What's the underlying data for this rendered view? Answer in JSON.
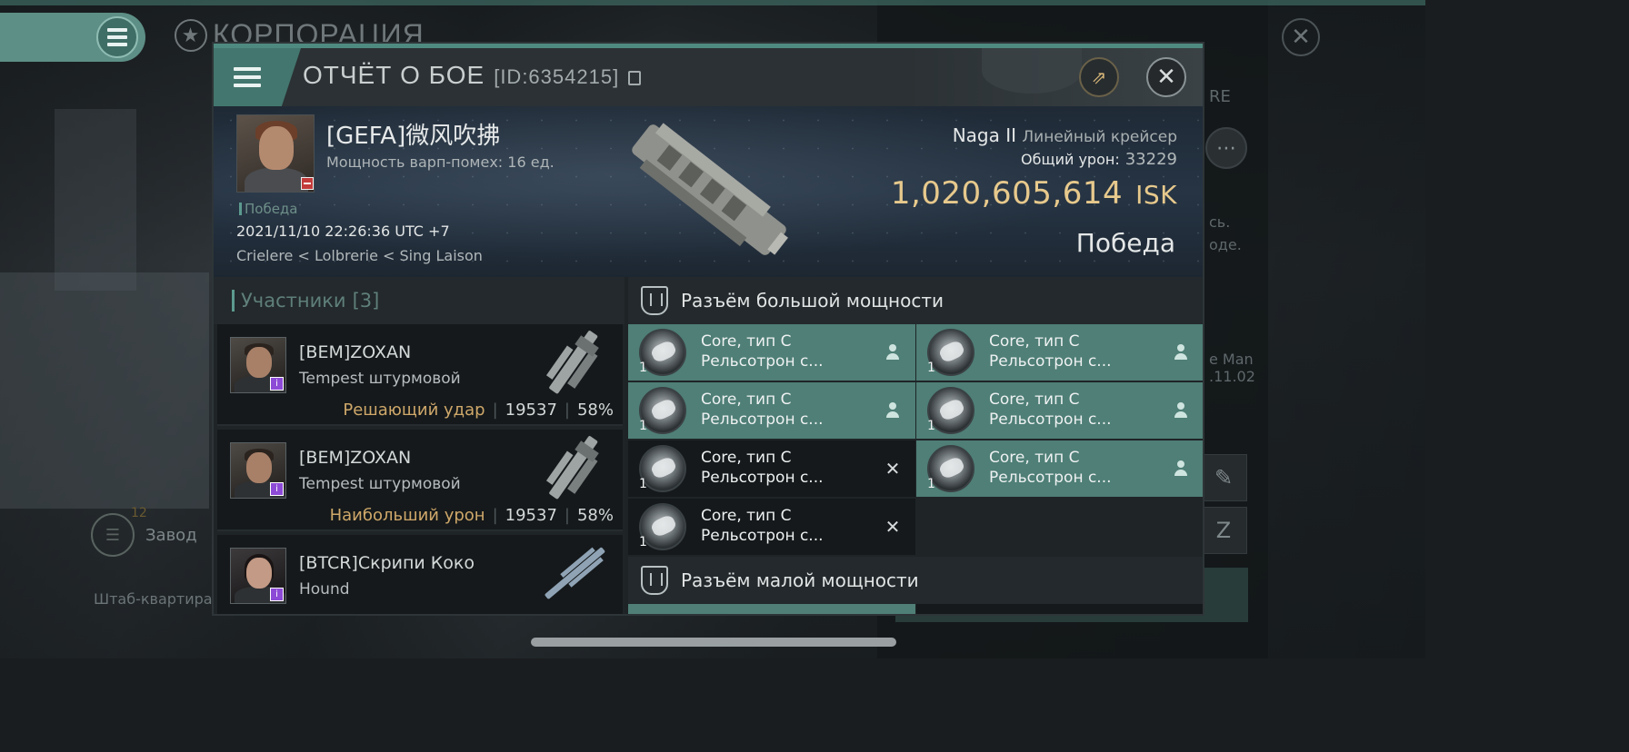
{
  "background": {
    "corp_title": "КОРПОРАЦИЯ",
    "side_fragment_re": "RE",
    "side_text_1": "сь.",
    "side_text_2": "оде.",
    "side_text_3": "e Man",
    "side_text_4": ".11.02",
    "factory_label": "Завод",
    "factory_count": "12",
    "hq_label": "Штаб-квартира"
  },
  "report": {
    "title": "ОТЧЁТ О БОЕ",
    "id": "[ID:6354215]"
  },
  "victim": {
    "pilot": "[GEFA]微风吹拂",
    "warp": "Мощность варп-помех: 16 ед.",
    "tag": "Победа",
    "datetime": "2021/11/10 22:26:36 UTC +7",
    "location": "Crielere < Lolbrerie < Sing Laison",
    "ship_name": "Naga II",
    "ship_class": "Линейный крейсер",
    "total_damage_label": "Общий урон:",
    "total_damage": "33229",
    "value": "1,020,605,614",
    "currency": "ISK",
    "result": "Победа"
  },
  "participants": {
    "label": "Участники",
    "count": "[3]",
    "rows": [
      {
        "name": "[BEM]ZOXAN",
        "ship": "Tempest штурмовой",
        "role": "Решающий удар",
        "damage": "19537",
        "percent": "58%"
      },
      {
        "name": "[BEM]ZOXAN",
        "ship": "Tempest штурмовой",
        "role": "Наибольший урон",
        "damage": "19537",
        "percent": "58%"
      },
      {
        "name": "[BTCR]Скрипи Коко",
        "ship": "Hound"
      }
    ]
  },
  "fittings": {
    "high_slot_title": "Разъём большой мощности",
    "low_slot_title": "Разъём малой мощности",
    "high_modules": [
      {
        "name": "Core, тип C",
        "sub": "Рельсотрон с...",
        "qty": "1",
        "status": "dropped"
      },
      {
        "name": "Core, тип C",
        "sub": "Рельсотрон с...",
        "qty": "1",
        "status": "dropped"
      },
      {
        "name": "Core, тип C",
        "sub": "Рельсотрон с...",
        "qty": "1",
        "status": "dropped"
      },
      {
        "name": "Core, тип C",
        "sub": "Рельсотрон с...",
        "qty": "1",
        "status": "dropped"
      },
      {
        "name": "Core, тип C",
        "sub": "Рельсотрон с...",
        "qty": "1",
        "status": "destroyed"
      },
      {
        "name": "Core, тип C",
        "sub": "Рельсотрон с...",
        "qty": "1",
        "status": "dropped"
      },
      {
        "name": "Core, тип C",
        "sub": "Рельсотрон с...",
        "qty": "1",
        "status": "destroyed"
      }
    ]
  },
  "colors": {
    "accent": "#4f8a80",
    "gold": "#e7c98c",
    "dropped_bg": "#4f7f77",
    "destroyed_bg": "#15191b"
  }
}
